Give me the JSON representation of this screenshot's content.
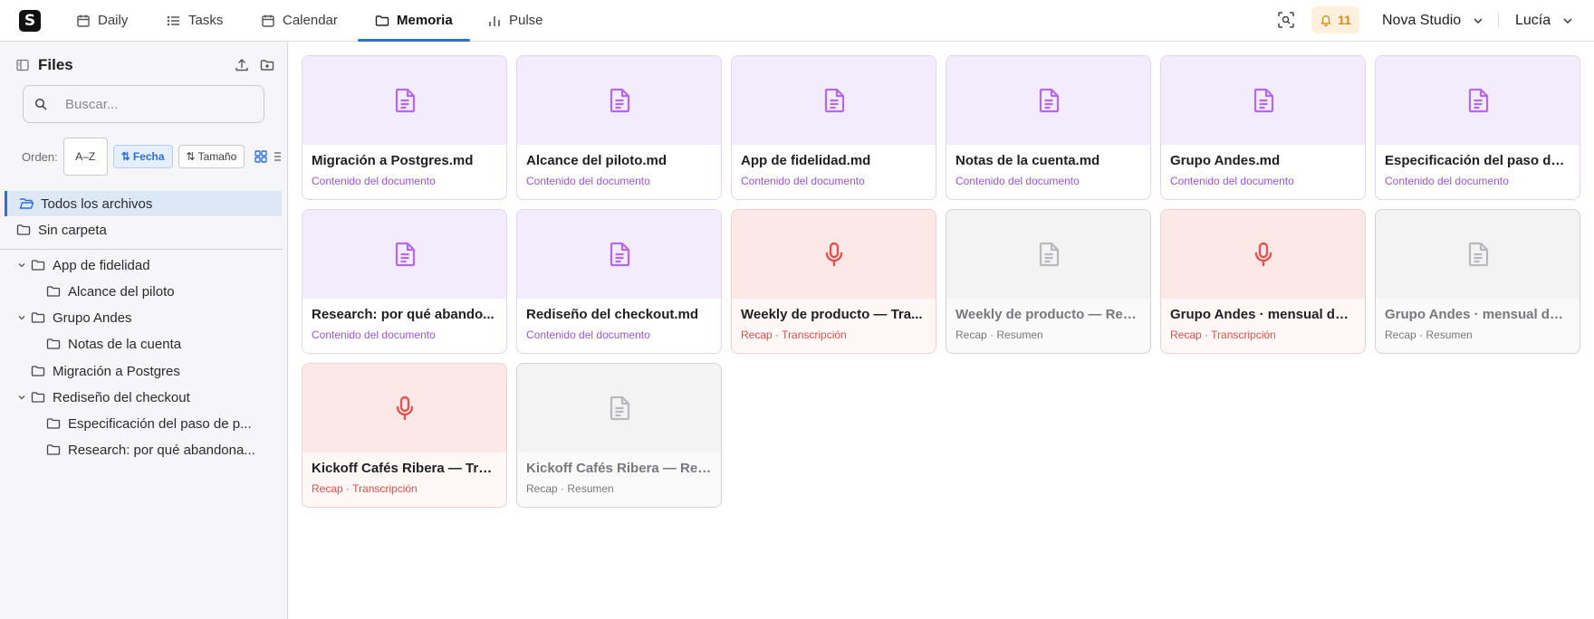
{
  "app": {
    "logo_glyph": "S",
    "accent": "#2a6fd6"
  },
  "nav": {
    "tabs": [
      {
        "label": "Daily",
        "icon": "calendar-day-icon"
      },
      {
        "label": "Tasks",
        "icon": "list-icon"
      },
      {
        "label": "Calendar",
        "icon": "calendar-icon"
      },
      {
        "label": "Memoria",
        "icon": "folder-icon",
        "active": true
      },
      {
        "label": "Pulse",
        "icon": "bar-chart-icon"
      }
    ],
    "notifications": "11",
    "workspace": "Nova Studio",
    "user": "Lucía"
  },
  "sidebar": {
    "title": "Files",
    "search_placeholder": "Buscar...",
    "sort": {
      "label": "Orden:",
      "az": "A–Z",
      "date": "Fecha",
      "size": "Tamaño",
      "active": "Fecha"
    },
    "all_files": "Todos los archivos",
    "no_folder": "Sin carpeta",
    "tree": [
      {
        "label": "App de fidelidad",
        "level": 0,
        "expanded": true
      },
      {
        "label": "Alcance del piloto",
        "level": 1
      },
      {
        "label": "Grupo Andes",
        "level": 0,
        "expanded": true
      },
      {
        "label": "Notas de la cuenta",
        "level": 1
      },
      {
        "label": "Migración a Postgres",
        "level": 0
      },
      {
        "label": "Rediseño del checkout",
        "level": 0,
        "expanded": true
      },
      {
        "label": "Especificación del paso de p...",
        "level": 1
      },
      {
        "label": "Research: por qué abandona...",
        "level": 1
      }
    ]
  },
  "files": [
    {
      "name": "Migración a Postgres.md",
      "meta": "Contenido del documento",
      "kind": "doc"
    },
    {
      "name": "Alcance del piloto.md",
      "meta": "Contenido del documento",
      "kind": "doc"
    },
    {
      "name": "App de fidelidad.md",
      "meta": "Contenido del documento",
      "kind": "doc"
    },
    {
      "name": "Notas de la cuenta.md",
      "meta": "Contenido del documento",
      "kind": "doc"
    },
    {
      "name": "Grupo Andes.md",
      "meta": "Contenido del documento",
      "kind": "doc"
    },
    {
      "name": "Especificación del paso de ...",
      "meta": "Contenido del documento",
      "kind": "doc"
    },
    {
      "name": "Research: por qué abando...",
      "meta": "Contenido del documento",
      "kind": "doc"
    },
    {
      "name": "Rediseño del checkout.md",
      "meta": "Contenido del documento",
      "kind": "doc"
    },
    {
      "name": "Weekly de producto — Tra...",
      "meta": "Recap · Transcripción",
      "kind": "audio"
    },
    {
      "name": "Weekly de producto — Res...",
      "meta": "Recap · Resumen",
      "kind": "summary"
    },
    {
      "name": "Grupo Andes · mensual de ...",
      "meta": "Recap · Transcripción",
      "kind": "audio"
    },
    {
      "name": "Grupo Andes · mensual de ...",
      "meta": "Recap · Resumen",
      "kind": "summary"
    },
    {
      "name": "Kickoff Cafés Ribera — Tra...",
      "meta": "Recap · Transcripción",
      "kind": "audio"
    },
    {
      "name": "Kickoff Cafés Ribera — Res...",
      "meta": "Recap · Resumen",
      "kind": "summary"
    }
  ],
  "colors": {
    "doc_icon": "#b46ae6",
    "audio_icon": "#e0534f",
    "summary_icon": "#b8b8bd",
    "bell": "#d98a12"
  }
}
